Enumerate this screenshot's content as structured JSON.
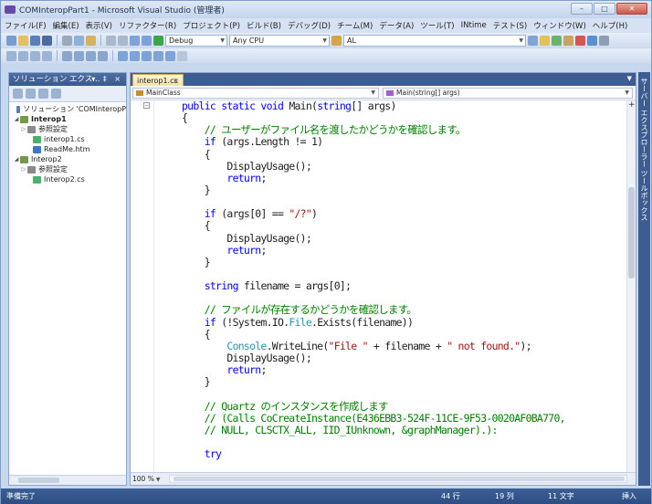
{
  "window": {
    "title": "COMInteropPart1 - Microsoft Visual Studio (管理者)",
    "buttons": [
      "–",
      "□",
      "✕"
    ]
  },
  "menu": [
    "ファイル(F)",
    "編集(E)",
    "表示(V)",
    "リファクター(R)",
    "プロジェクト(P)",
    "ビルド(B)",
    "デバッグ(D)",
    "チーム(M)",
    "データ(A)",
    "ツール(T)",
    "INtime",
    "テスト(S)",
    "ウィンドウ(W)",
    "ヘルプ(H)"
  ],
  "toolbar": {
    "config": "Debug",
    "platform": "Any CPU",
    "find": "AL"
  },
  "solution_explorer": {
    "title": "ソリューション エクス...",
    "header_buttons": "▾ ‡ ×",
    "tree": [
      {
        "label": "ソリューション 'COMInteropP",
        "bold": false,
        "icon_color": "#5a7fb8",
        "twisty": ""
      },
      {
        "label": "Interop1",
        "bold": true,
        "icon_color": "#6e9b4c",
        "twisty": "◢"
      },
      {
        "label": "参照設定",
        "bold": false,
        "icon_color": "#8a8a8a",
        "twisty": "▷"
      },
      {
        "label": "interop1.cs",
        "bold": false,
        "icon_color": "#4caf6c",
        "twisty": ""
      },
      {
        "label": "ReadMe.htm",
        "bold": false,
        "icon_color": "#3b78c3",
        "twisty": ""
      },
      {
        "label": "Interop2",
        "bold": false,
        "icon_color": "#6e9b4c",
        "twisty": "◢"
      },
      {
        "label": "参照設定",
        "bold": false,
        "icon_color": "#8a8a8a",
        "twisty": "▷"
      },
      {
        "label": "Interop2.cs",
        "bold": false,
        "icon_color": "#4caf6c",
        "twisty": ""
      }
    ]
  },
  "editor": {
    "tab": "interop1.cs",
    "tab_close": "×",
    "nav_class": "MainClass",
    "nav_member": "Main(string[] args)",
    "zoom": "100 %",
    "code": [
      [
        {
          "t": "public static void ",
          "c": "kw"
        },
        {
          "t": "Main(",
          "c": ""
        },
        {
          "t": "string",
          "c": "kw"
        },
        {
          "t": "[] args)",
          "c": ""
        }
      ],
      [
        {
          "t": "{",
          "c": ""
        }
      ],
      [
        {
          "t": "    // ユーザーがファイル名を渡したかどうかを確認します。",
          "c": "cm"
        }
      ],
      [
        {
          "t": "    ",
          "c": ""
        },
        {
          "t": "if",
          "c": "kw"
        },
        {
          "t": " (args.Length != 1)",
          "c": ""
        }
      ],
      [
        {
          "t": "    {",
          "c": ""
        }
      ],
      [
        {
          "t": "        DisplayUsage();",
          "c": ""
        }
      ],
      [
        {
          "t": "        ",
          "c": ""
        },
        {
          "t": "return",
          "c": "kw"
        },
        {
          "t": ";",
          "c": ""
        }
      ],
      [
        {
          "t": "    }",
          "c": ""
        }
      ],
      [
        {
          "t": "",
          "c": ""
        }
      ],
      [
        {
          "t": "    ",
          "c": ""
        },
        {
          "t": "if",
          "c": "kw"
        },
        {
          "t": " (args[0] == ",
          "c": ""
        },
        {
          "t": "\"/?\"",
          "c": "st"
        },
        {
          "t": ")",
          "c": ""
        }
      ],
      [
        {
          "t": "    {",
          "c": ""
        }
      ],
      [
        {
          "t": "        DisplayUsage();",
          "c": ""
        }
      ],
      [
        {
          "t": "        ",
          "c": ""
        },
        {
          "t": "return",
          "c": "kw"
        },
        {
          "t": ";",
          "c": ""
        }
      ],
      [
        {
          "t": "    }",
          "c": ""
        }
      ],
      [
        {
          "t": "",
          "c": ""
        }
      ],
      [
        {
          "t": "    ",
          "c": ""
        },
        {
          "t": "string",
          "c": "kw"
        },
        {
          "t": " filename = args[0];",
          "c": ""
        }
      ],
      [
        {
          "t": "",
          "c": ""
        }
      ],
      [
        {
          "t": "    // ファイルが存在するかどうかを確認します。",
          "c": "cm"
        }
      ],
      [
        {
          "t": "    ",
          "c": ""
        },
        {
          "t": "if",
          "c": "kw"
        },
        {
          "t": " (!System.IO.",
          "c": ""
        },
        {
          "t": "File",
          "c": "ty"
        },
        {
          "t": ".Exists(filename))",
          "c": ""
        }
      ],
      [
        {
          "t": "    {",
          "c": ""
        }
      ],
      [
        {
          "t": "        ",
          "c": ""
        },
        {
          "t": "Console",
          "c": "ty"
        },
        {
          "t": ".WriteLine(",
          "c": ""
        },
        {
          "t": "\"File \"",
          "c": "st"
        },
        {
          "t": " + filename + ",
          "c": ""
        },
        {
          "t": "\" not found.\"",
          "c": "st"
        },
        {
          "t": ");",
          "c": ""
        }
      ],
      [
        {
          "t": "        DisplayUsage();",
          "c": ""
        }
      ],
      [
        {
          "t": "        ",
          "c": ""
        },
        {
          "t": "return",
          "c": "kw"
        },
        {
          "t": ";",
          "c": ""
        }
      ],
      [
        {
          "t": "    }",
          "c": ""
        }
      ],
      [
        {
          "t": "",
          "c": ""
        }
      ],
      [
        {
          "t": "    // Quartz のインスタンスを作成します",
          "c": "cm"
        }
      ],
      [
        {
          "t": "    // (Calls CoCreateInstance(E436EBB3-524F-11CE-9F53-0020AF0BA770,",
          "c": "cm"
        }
      ],
      [
        {
          "t": "    // NULL, CLSCTX_ALL, IID_IUnknown, &graphManager).):",
          "c": "cm"
        }
      ],
      [
        {
          "t": "",
          "c": ""
        }
      ],
      [
        {
          "t": "    ",
          "c": ""
        },
        {
          "t": "try",
          "c": "kw"
        }
      ]
    ]
  },
  "side_rail": "サーバー エクスプローラー ツールボックス",
  "status": {
    "message": "準備完了",
    "line": "44 行",
    "col": "19 列",
    "chars": "11 文字",
    "mode": "挿入"
  }
}
